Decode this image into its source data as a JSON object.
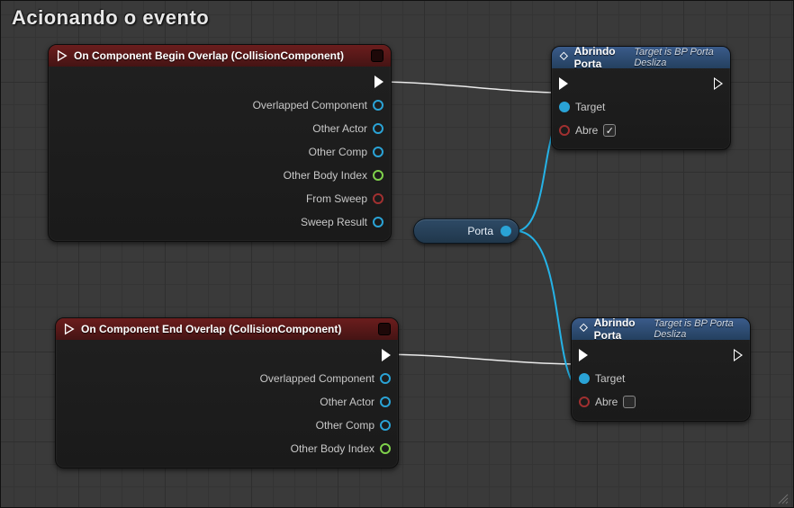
{
  "title": "Acionando o evento",
  "colors": {
    "event_header": "#6b1d1d",
    "func_header": "#3a5b8a",
    "pin_object": "#2aa3d6",
    "pin_struct": "#7fd14b",
    "pin_bool": "#a03030"
  },
  "variable_node": {
    "label": "Porta"
  },
  "nodes": {
    "event_begin": {
      "title": "On Component Begin Overlap (CollisionComponent)",
      "outputs": [
        {
          "label": "",
          "kind": "exec"
        },
        {
          "label": "Overlapped Component",
          "kind": "object"
        },
        {
          "label": "Other Actor",
          "kind": "object"
        },
        {
          "label": "Other Comp",
          "kind": "object"
        },
        {
          "label": "Other Body Index",
          "kind": "struct"
        },
        {
          "label": "From Sweep",
          "kind": "bool"
        },
        {
          "label": "Sweep Result",
          "kind": "object"
        }
      ]
    },
    "event_end": {
      "title": "On Component End Overlap (CollisionComponent)",
      "outputs": [
        {
          "label": "",
          "kind": "exec"
        },
        {
          "label": "Overlapped Component",
          "kind": "object"
        },
        {
          "label": "Other Actor",
          "kind": "object"
        },
        {
          "label": "Other Comp",
          "kind": "object"
        },
        {
          "label": "Other Body Index",
          "kind": "struct"
        }
      ]
    },
    "func_top": {
      "title": "Abrindo Porta",
      "subtitle": "Target is BP Porta Desliza",
      "inputs": [
        {
          "label": "",
          "kind": "exec"
        },
        {
          "label": "Target",
          "kind": "object"
        },
        {
          "label": "Abre",
          "kind": "bool",
          "checked": true
        }
      ]
    },
    "func_bottom": {
      "title": "Abrindo Porta",
      "subtitle": "Target is BP Porta Desliza",
      "inputs": [
        {
          "label": "",
          "kind": "exec"
        },
        {
          "label": "Target",
          "kind": "object"
        },
        {
          "label": "Abre",
          "kind": "bool",
          "checked": false
        }
      ]
    }
  }
}
